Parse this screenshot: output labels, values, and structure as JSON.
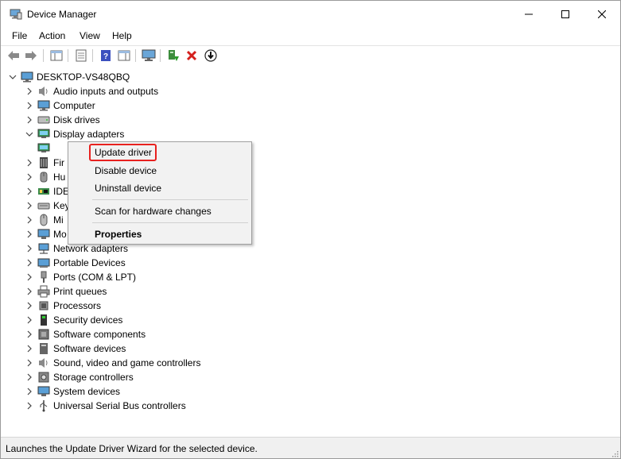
{
  "window": {
    "title": "Device Manager"
  },
  "menu": [
    "File",
    "Action",
    "View",
    "Help"
  ],
  "tree": {
    "root": "DESKTOP-VS48QBQ",
    "categories": [
      {
        "label": "Audio inputs and outputs",
        "icon": "speaker-icon"
      },
      {
        "label": "Computer",
        "icon": "computer-icon"
      },
      {
        "label": "Disk drives",
        "icon": "disk-drive-icon"
      },
      {
        "label": "Display adapters",
        "icon": "display-adapter-icon",
        "expanded": true
      },
      {
        "label": "",
        "icon": "display-adapter-device-icon",
        "child": true
      },
      {
        "label": "Firmware",
        "visible": "Fir",
        "icon": "firmware-icon"
      },
      {
        "label": "Human Interface Devices",
        "visible": "Hu",
        "icon": "hid-icon"
      },
      {
        "label": "IDE ATA/ATAPI controllers",
        "visible": "IDE",
        "icon": "ide-icon"
      },
      {
        "label": "Keyboards",
        "visible": "Key",
        "icon": "keyboard-icon"
      },
      {
        "label": "Mice and other pointing devices",
        "visible": "Mi",
        "icon": "mouse-icon"
      },
      {
        "label": "Monitors",
        "visible": "Mo",
        "icon": "monitor-icon"
      },
      {
        "label": "Network adapters",
        "icon": "network-icon"
      },
      {
        "label": "Portable Devices",
        "icon": "portable-icon"
      },
      {
        "label": "Ports (COM & LPT)",
        "icon": "port-icon"
      },
      {
        "label": "Print queues",
        "icon": "printer-icon"
      },
      {
        "label": "Processors",
        "icon": "processor-icon"
      },
      {
        "label": "Security devices",
        "icon": "security-icon"
      },
      {
        "label": "Software components",
        "icon": "software-component-icon"
      },
      {
        "label": "Software devices",
        "icon": "software-device-icon"
      },
      {
        "label": "Sound, video and game controllers",
        "icon": "sound-icon"
      },
      {
        "label": "Storage controllers",
        "icon": "storage-icon"
      },
      {
        "label": "System devices",
        "icon": "system-icon"
      },
      {
        "label": "Universal Serial Bus controllers",
        "icon": "usb-icon"
      }
    ]
  },
  "context_menu": {
    "update": "Update driver",
    "disable": "Disable device",
    "uninstall": "Uninstall device",
    "scan": "Scan for hardware changes",
    "properties": "Properties"
  },
  "status": "Launches the Update Driver Wizard for the selected device.",
  "colors": {
    "highlight_border": "#e8211f",
    "menu_bg": "#f2f2f2"
  }
}
